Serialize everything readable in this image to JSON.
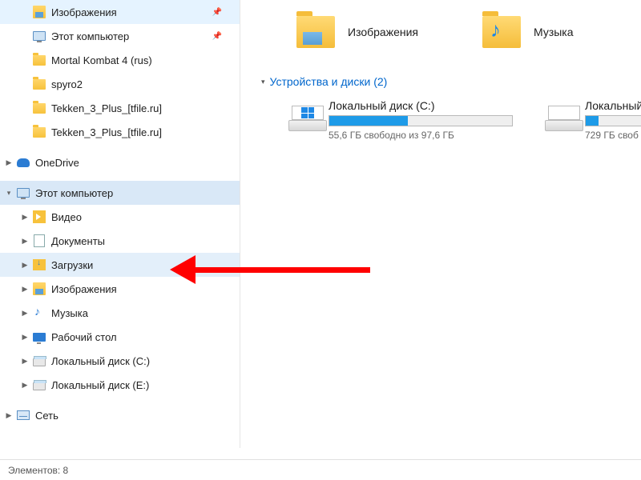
{
  "sidebar": {
    "quick_access": [
      {
        "label": "Изображения",
        "icon": "pictures",
        "pinned": true
      },
      {
        "label": "Этот компьютер",
        "icon": "pc",
        "pinned": true
      },
      {
        "label": "Mortal Kombat 4 (rus)",
        "icon": "folder"
      },
      {
        "label": "spyro2",
        "icon": "folder"
      },
      {
        "label": "Tekken_3_Plus_[tfile.ru]",
        "icon": "folder"
      },
      {
        "label": "Tekken_3_Plus_[tfile.ru]",
        "icon": "folder"
      }
    ],
    "onedrive_label": "OneDrive",
    "this_pc_label": "Этот компьютер",
    "this_pc_children": [
      {
        "label": "Видео",
        "icon": "video"
      },
      {
        "label": "Документы",
        "icon": "docs"
      },
      {
        "label": "Загрузки",
        "icon": "downloads",
        "highlighted": true
      },
      {
        "label": "Изображения",
        "icon": "pictures"
      },
      {
        "label": "Музыка",
        "icon": "music"
      },
      {
        "label": "Рабочий стол",
        "icon": "desktop"
      },
      {
        "label": "Локальный диск (C:)",
        "icon": "drive"
      },
      {
        "label": "Локальный диск (E:)",
        "icon": "drive"
      }
    ],
    "network_label": "Сеть"
  },
  "main": {
    "folder_tiles": [
      {
        "label": "Изображения",
        "kind": "pictures"
      },
      {
        "label": "Музыка",
        "kind": "music"
      }
    ],
    "drives_header": "Устройства и диски (2)",
    "drives": [
      {
        "name": "Локальный диск (C:)",
        "free_text": "55,6 ГБ свободно из 97,6 ГБ",
        "fill_pct": 43,
        "winlogo": true
      },
      {
        "name": "Локальный",
        "free_text": "729 ГБ своб",
        "fill_pct": 18,
        "winlogo": false
      }
    ]
  },
  "statusbar": {
    "items_label": "Элементов: 8"
  }
}
